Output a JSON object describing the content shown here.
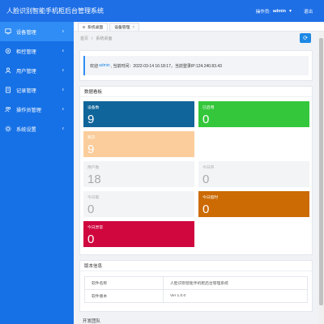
{
  "header": {
    "title": "人脸识别智能手机柜后台管理系统",
    "operator_label": "操作员:",
    "user": "admin",
    "logout": "退出"
  },
  "sidebar": {
    "items": [
      {
        "label": "设备管理",
        "icon": "device-icon",
        "active": true
      },
      {
        "label": "柜控管理",
        "icon": "cabinet-icon"
      },
      {
        "label": "用户管理",
        "icon": "user-icon"
      },
      {
        "label": "记录管理",
        "icon": "record-icon"
      },
      {
        "label": "操作员管理",
        "icon": "operator-icon"
      },
      {
        "label": "系统设置",
        "icon": "settings-icon"
      }
    ]
  },
  "tabs": [
    {
      "label": "系统桌面",
      "active": true
    },
    {
      "label": "设备管理"
    }
  ],
  "breadcrumb": {
    "home": "首页",
    "sep": "/",
    "current": "系统桌面"
  },
  "welcome": {
    "prefix": "欢迎",
    "user": "admin",
    "text": ", 当前时间：2022-03-14 16:18:17，当前登录IP:124.240.83.43"
  },
  "dashboard": {
    "title": "数据看板",
    "stats": [
      {
        "label": "设备数",
        "value": "9",
        "color": "#10659a"
      },
      {
        "label": "已启用",
        "value": "0",
        "color": "#34c73b"
      },
      {
        "label": "离开",
        "value": "9",
        "color": "#fbcd9c"
      },
      {
        "label": "用户数",
        "value": "18",
        "color": "#f3f4f6"
      },
      {
        "label": "今日存",
        "value": "0",
        "color": "#f3f4f6"
      },
      {
        "label": "今日取",
        "value": "0",
        "color": "#f3f4f6"
      },
      {
        "label": "今日超时",
        "value": "0",
        "color": "#cc6a04"
      },
      {
        "label": "今日异常",
        "value": "0",
        "color": "#d0073f"
      }
    ]
  },
  "version": {
    "title": "版本信息",
    "rows": [
      {
        "key": "软件名称",
        "value": "人脸识别智能手机柜后台管理系统"
      },
      {
        "key": "软件版本",
        "value": "Ver 1.0.0"
      }
    ]
  },
  "team": {
    "title": "开发团队"
  },
  "colors": {
    "header": "#1e6fe6",
    "sidebar": "#1671e6",
    "sidebar_active": "#2f8df5",
    "accent": "#1e88e5"
  }
}
